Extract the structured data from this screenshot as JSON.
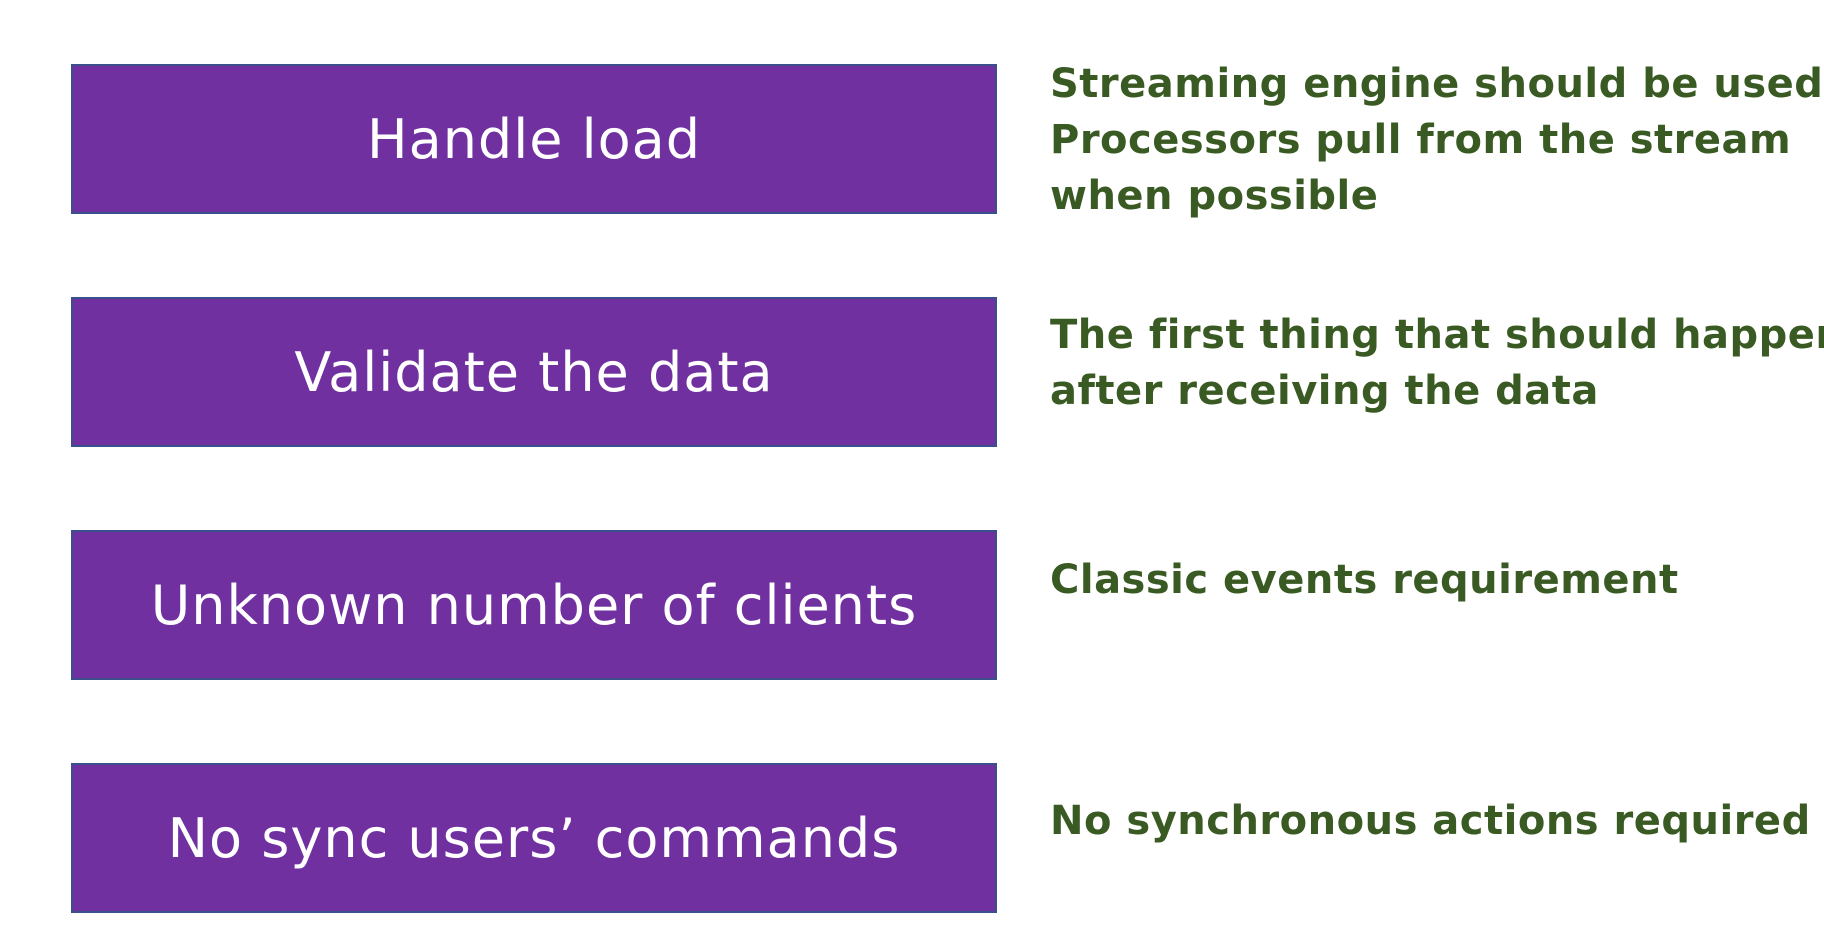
{
  "colors": {
    "box_fill": "#7030a0",
    "box_text": "#ffffff",
    "note_text": "#3a5a23"
  },
  "rows": [
    {
      "label": "Handle load",
      "note_lines": [
        "Streaming engine should be used.",
        "Processors pull from the stream",
        "when possible"
      ]
    },
    {
      "label": "Validate the data",
      "note_lines": [
        "The first thing that should happen",
        "after receiving the data"
      ]
    },
    {
      "label": "Unknown number of clients",
      "note_lines": [
        "Classic events requirement"
      ]
    },
    {
      "label": "No sync users’ commands",
      "note_lines": [
        "No synchronous actions required"
      ]
    }
  ]
}
